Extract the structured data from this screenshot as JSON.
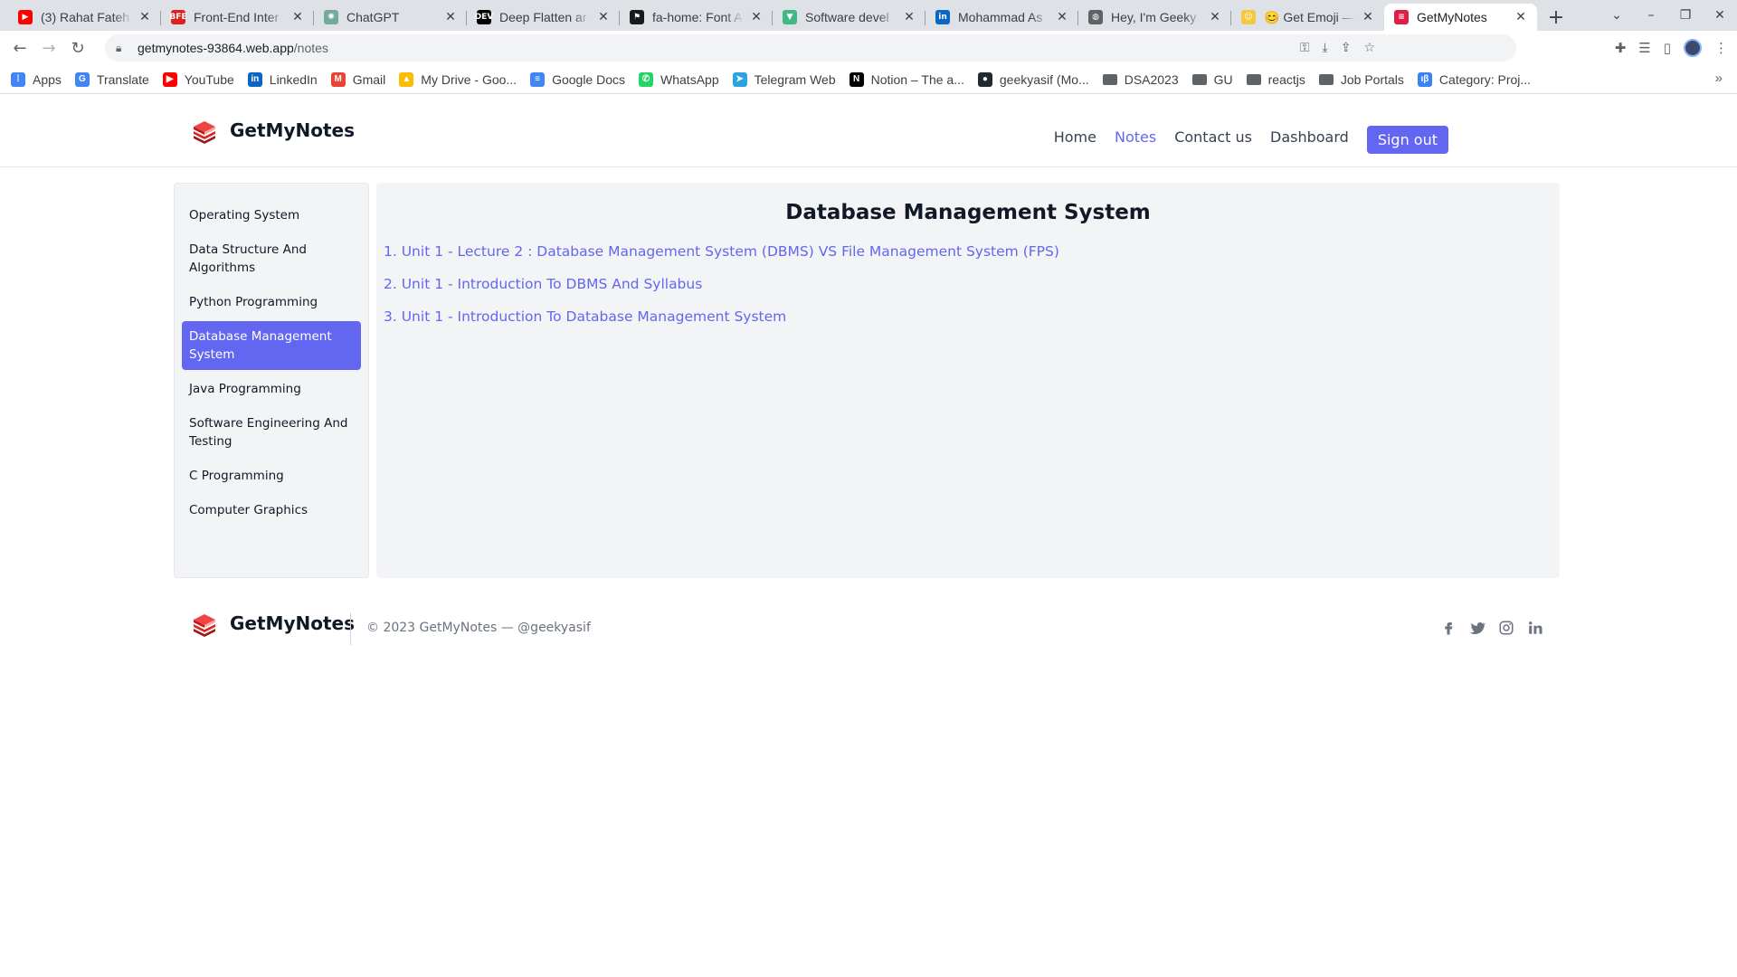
{
  "browser": {
    "tabs": [
      {
        "title": "(3) Rahat Fateh",
        "icon": "youtube-icon",
        "color": "#ff0000",
        "glyph": "▶"
      },
      {
        "title": "Front-End Inter",
        "icon": "bfe-icon",
        "color": "#e02020",
        "glyph": "BFE"
      },
      {
        "title": "ChatGPT",
        "icon": "chatgpt-icon",
        "color": "#74aa9c",
        "glyph": "✺"
      },
      {
        "title": "Deep Flatten ar",
        "icon": "dev-icon",
        "color": "#000000",
        "glyph": "DEV"
      },
      {
        "title": "fa-home: Font A",
        "icon": "flag-icon",
        "color": "#1a1a1a",
        "glyph": "⚑"
      },
      {
        "title": "Software devel",
        "icon": "vue-icon",
        "color": "#41b883",
        "glyph": "▼"
      },
      {
        "title": "Mohammad As",
        "icon": "linkedin-icon",
        "color": "#0a66c2",
        "glyph": "in"
      },
      {
        "title": "Hey, I'm Geeky",
        "icon": "globe-icon",
        "color": "#5f6368",
        "glyph": "◍"
      },
      {
        "title": "😊 Get Emoji —",
        "icon": "emoji-icon",
        "color": "#f5c842",
        "glyph": "☺"
      },
      {
        "title": "GetMyNotes",
        "icon": "getmynotes-icon",
        "color": "#e11d48",
        "glyph": "≡",
        "active": true
      }
    ],
    "url_host": "getmynotes-93864.web.app",
    "url_path": "/notes",
    "bookmarks": [
      {
        "label": "Apps",
        "icon": "apps-icon",
        "color": "#4285f4",
        "glyph": "⁞"
      },
      {
        "label": "Translate",
        "icon": "translate-icon",
        "color": "#4285f4",
        "glyph": "G"
      },
      {
        "label": "YouTube",
        "icon": "youtube-icon",
        "color": "#ff0000",
        "glyph": "▶"
      },
      {
        "label": "LinkedIn",
        "icon": "linkedin-icon",
        "color": "#0a66c2",
        "glyph": "in"
      },
      {
        "label": "Gmail",
        "icon": "gmail-icon",
        "color": "#ea4335",
        "glyph": "M"
      },
      {
        "label": "My Drive - Goo...",
        "icon": "drive-icon",
        "color": "#fbbc04",
        "glyph": "▲"
      },
      {
        "label": "Google Docs",
        "icon": "docs-icon",
        "color": "#4285f4",
        "glyph": "≡"
      },
      {
        "label": "WhatsApp",
        "icon": "whatsapp-icon",
        "color": "#25d366",
        "glyph": "✆"
      },
      {
        "label": "Telegram Web",
        "icon": "telegram-icon",
        "color": "#2aa3df",
        "glyph": "➤"
      },
      {
        "label": "Notion – The a...",
        "icon": "notion-icon",
        "color": "#000000",
        "glyph": "N"
      },
      {
        "label": "geekyasif (Mo...",
        "icon": "github-icon",
        "color": "#24292e",
        "glyph": "●"
      },
      {
        "label": "DSA2023",
        "icon": "folder-icon",
        "folder": true
      },
      {
        "label": "GU",
        "icon": "folder-icon",
        "folder": true
      },
      {
        "label": "reactjs",
        "icon": "folder-icon",
        "folder": true
      },
      {
        "label": "Job Portals",
        "icon": "folder-icon",
        "folder": true
      },
      {
        "label": "Category: Proj...",
        "icon": "category-icon",
        "color": "#3b82f6",
        "glyph": "ıβ"
      }
    ]
  },
  "site": {
    "brand": "GetMyNotes",
    "nav": [
      {
        "label": "Home",
        "active": false
      },
      {
        "label": "Notes",
        "active": true
      },
      {
        "label": "Contact us",
        "active": false
      },
      {
        "label": "Dashboard",
        "active": false
      }
    ],
    "signout_label": "Sign out",
    "accent": "#6366f1",
    "subjects": [
      {
        "label": "Operating System",
        "active": false
      },
      {
        "label": "Data Structure And Algorithms",
        "active": false
      },
      {
        "label": "Python Programming",
        "active": false
      },
      {
        "label": "Database Management System",
        "active": true
      },
      {
        "label": "Java Programming",
        "active": false
      },
      {
        "label": "Software Engineering And Testing",
        "active": false
      },
      {
        "label": "C Programming",
        "active": false
      },
      {
        "label": "Computer Graphics",
        "active": false
      }
    ],
    "content": {
      "title": "Database Management System",
      "notes": [
        "1. Unit 1 - Lecture 2 : Database Management System (DBMS) VS File Management System (FPS)",
        "2. Unit 1 - Introduction To DBMS And Syllabus",
        "3. Unit 1 - Introduction To Database Management System"
      ]
    },
    "footer": {
      "brand": "GetMyNotes",
      "copyright": "© 2023 GetMyNotes — @geekyasif",
      "socials": [
        "facebook-icon",
        "twitter-icon",
        "instagram-icon",
        "linkedin-icon"
      ]
    }
  }
}
